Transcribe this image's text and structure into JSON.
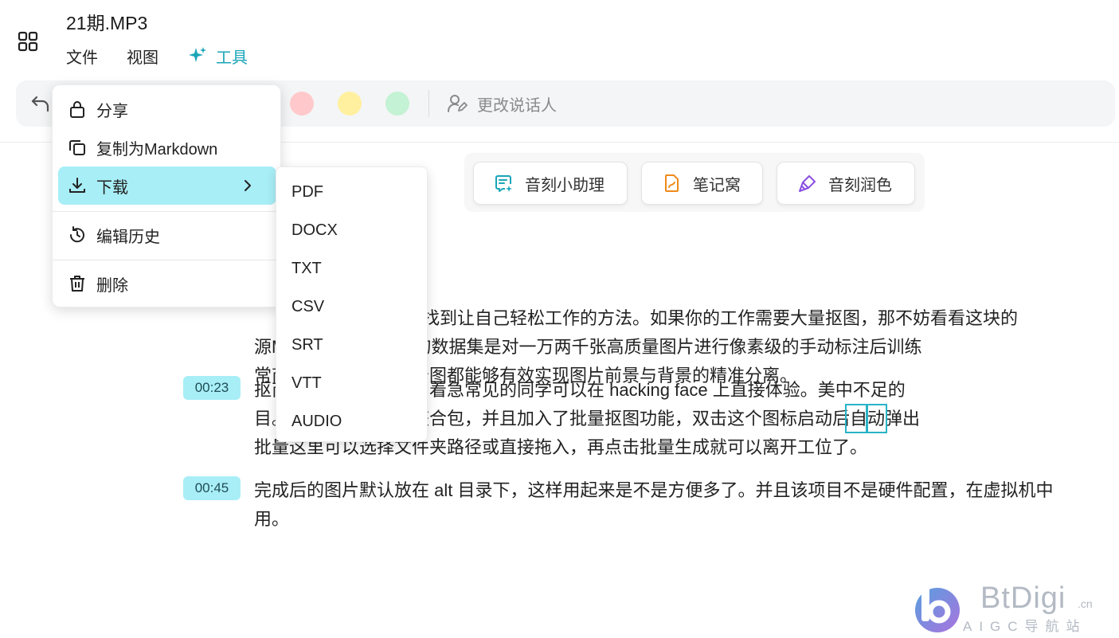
{
  "header": {
    "file_title": "21期.MP3",
    "menu": [
      "文件",
      "视图"
    ],
    "tools_label": "工具"
  },
  "toolbar": {
    "swatches": [
      "#ffc9cc",
      "#fff0a0",
      "#c4f2d4"
    ],
    "change_speaker": "更改说话人"
  },
  "ai_buttons": [
    {
      "label": "音刻小助理",
      "icon": "assistant-icon",
      "color": "#1aa5b8"
    },
    {
      "label": "笔记窝",
      "icon": "note-icon",
      "color": "#f08a1c"
    },
    {
      "label": "音刻润色",
      "icon": "polish-icon",
      "color": "#8a4fe0"
    }
  ],
  "dropdown": {
    "items": [
      {
        "label": "分享",
        "icon": "lock-icon"
      },
      {
        "label": "复制为Markdown",
        "icon": "copy-icon"
      },
      {
        "label": "下载",
        "icon": "download-icon",
        "active": true
      },
      {
        "label": "编辑历史",
        "icon": "history-icon"
      },
      {
        "label": "删除",
        "icon": "trash-icon"
      }
    ]
  },
  "download_submenu": [
    "PDF",
    "DOCX",
    "TXT",
    "CSV",
    "SRT",
    "VTT",
    "AUDIO"
  ],
  "transcript": [
    {
      "timestamp": "",
      "lines": [
        "，越能找到让自己轻松工作的方法。如果你的工作需要大量抠图，那不妨看看这块的",
        "源MBG . 该项目模型的数据集是对一万两千张高质量图片进行像素级的手动标注后训练",
        "常商图、游戏图和广告图都能够有效实现图片前景与背景的精准分离。"
      ]
    },
    {
      "timestamp": "00:23",
      "lines": [
        "抠商业项目相媲美了，着急常见的同学可以在 hacking face 上直接体验。美中不足的",
        "目。那我这里做了个整合包，并且加入了批量抠图功能，双击这个图标启动后自动弹出",
        "批量这里可以选择文件夹路径或直接拖入，再点击批量生成就可以离开工位了。"
      ]
    },
    {
      "timestamp": "00:45",
      "lines": [
        "完成后的图片默认放在 alt 目录下，这样用起来是不是方便多了。并且该项目不是硬件配置，在虚拟机中",
        "用。"
      ]
    }
  ],
  "watermark": {
    "word": "BtDigi",
    "suffix": ".cn",
    "sub": "AIGC导航站"
  }
}
